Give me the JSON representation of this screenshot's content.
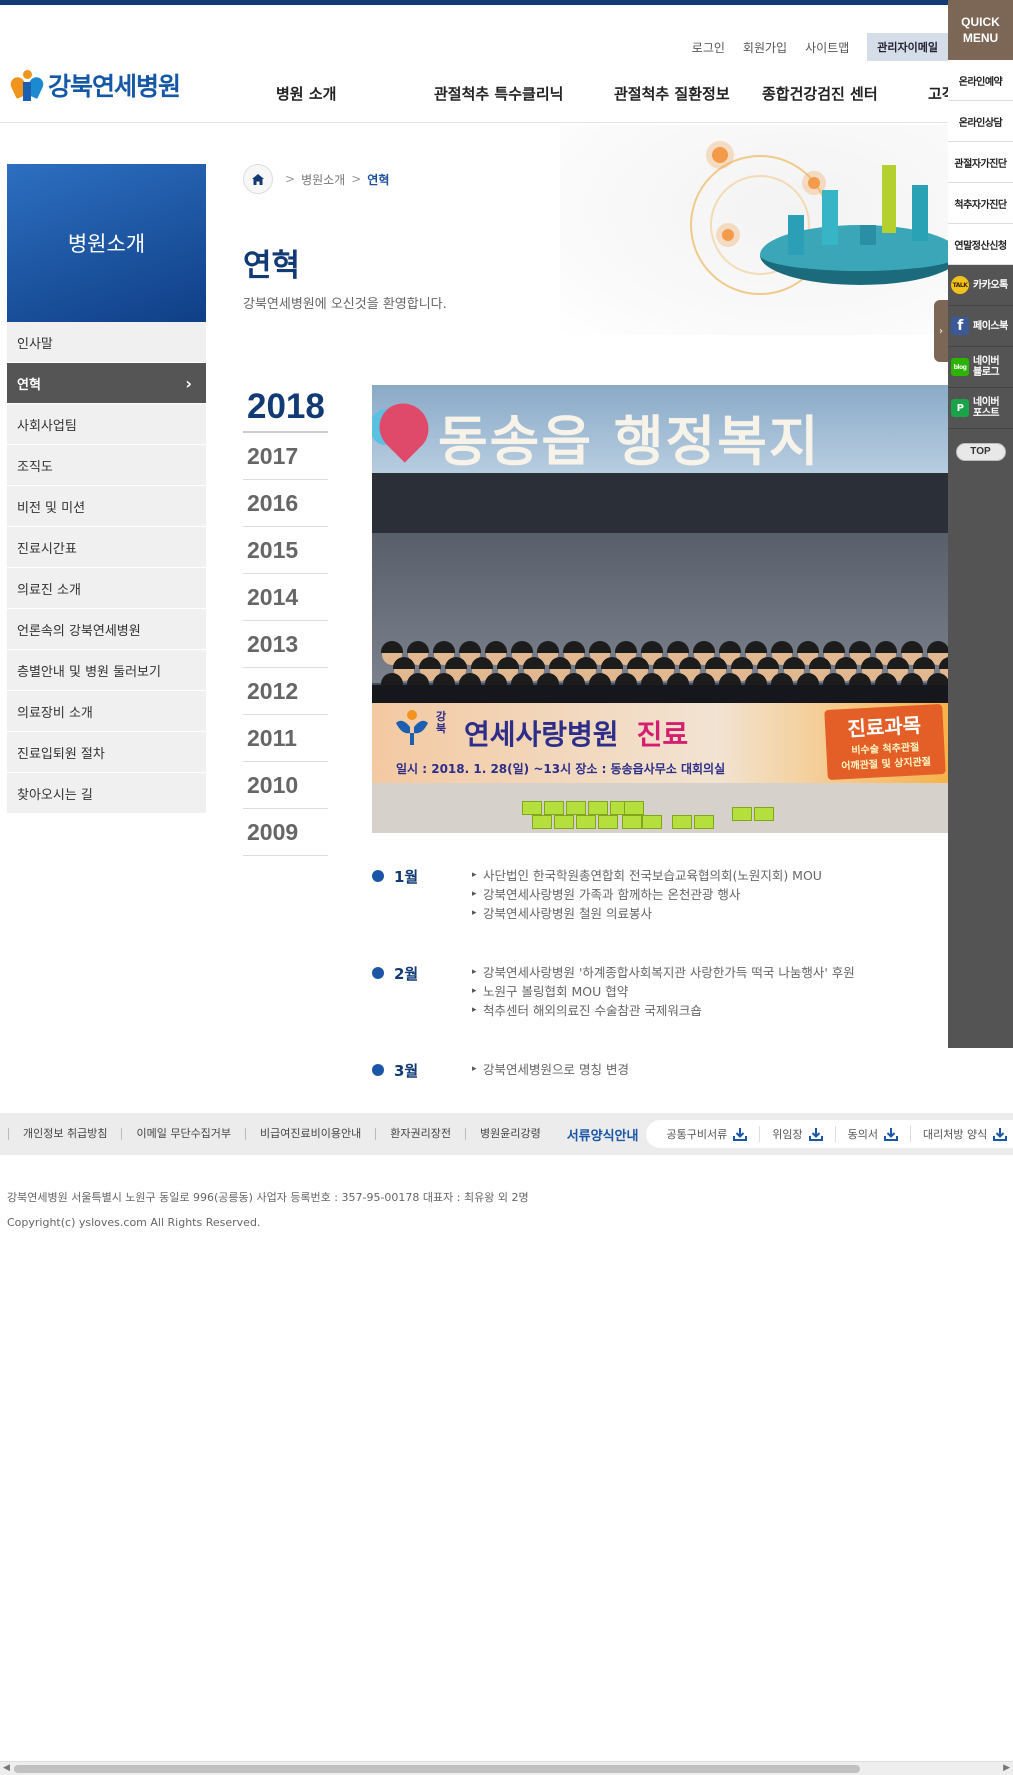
{
  "header": {
    "logo_text": "강북연세병원",
    "util_links": [
      "로그인",
      "회원가입",
      "사이트맵"
    ],
    "admin_mail": "관리자이메일",
    "gnb": [
      "병원 소개",
      "관절척추 특수클리닉",
      "관절척추 질환정보",
      "종합건강검진 센터",
      "고객"
    ]
  },
  "quick_menu": {
    "title_line1": "QUICK",
    "title_line2": "MENU",
    "items": [
      "온라인예약",
      "온라인상담",
      "관절자가진단",
      "척추자가진단",
      "연말정산신청"
    ],
    "social": [
      {
        "label": "카카오톡",
        "icon": "kakaotalk-icon",
        "color": "#f2c21b",
        "glyph": "TALK"
      },
      {
        "label": "페이스북",
        "icon": "facebook-icon",
        "color": "#3b5998",
        "glyph": "f"
      },
      {
        "label": "네이버 블로그",
        "icon": "naver-blog-icon",
        "color": "#2db400",
        "glyph": "blog"
      },
      {
        "label": "네이버 포스트",
        "icon": "naver-post-icon",
        "color": "#19a44a",
        "glyph": "P"
      }
    ],
    "top": "TOP"
  },
  "lnb": {
    "title": "병원소개",
    "items": [
      "인사말",
      "연혁",
      "사회사업팀",
      "조직도",
      "비전 및 미션",
      "진료시간표",
      "의료진 소개",
      "언론속의 강북연세병원",
      "층별안내 및 병원 둘러보기",
      "의료장비 소개",
      "진료입퇴원 절차",
      "찾아오시는 길"
    ],
    "active_index": 1
  },
  "location": {
    "parent": "병원소개",
    "current": "연혁"
  },
  "page": {
    "title": "연혁",
    "description": "강북연세병원에 오신것을 환영합니다."
  },
  "years": [
    "2018",
    "2017",
    "2016",
    "2015",
    "2014",
    "2013",
    "2012",
    "2011",
    "2010",
    "2009"
  ],
  "photo": {
    "sign": "동송읍 행정복지",
    "banner_small_logo": "강북",
    "banner_main": "연세사랑병원",
    "banner_pink": "진료",
    "banner_detail": "일시 : 2018. 1. 28(일)                   ~13시     장소 : 동송읍사무소 대회의실",
    "tag_title": "진료과목",
    "tag_line1": "비수술 척추관절",
    "tag_line2": "어깨관절 및 상지관절"
  },
  "history": [
    {
      "month": "1월",
      "items": [
        "사단법인 한국학원총연합회 전국보습교육협의회(노원지회) MOU",
        "강북연세사랑병원 가족과 함께하는 온천관광 행사",
        "강북연세사랑병원 철원 의료봉사"
      ]
    },
    {
      "month": "2월",
      "items": [
        "강북연세사랑병원 '하계종합사회복지관 사랑한가득 떡국 나눔행사' 후원",
        "노원구 볼링협회 MOU 협약",
        "척추센터 해외의료진 수술참관 국제워크숍"
      ]
    },
    {
      "month": "3월",
      "items": [
        "강북연세병원으로 명칭 변경"
      ]
    }
  ],
  "footer": {
    "links": [
      "개인정보 취급방침",
      "이메일 무단수집거부",
      "비급여진료비이용안내",
      "환자권리장전",
      "병원윤리강령"
    ],
    "forms_title": "서류양식안내",
    "forms": [
      "공통구비서류",
      "위임장",
      "동의서",
      "대리처방 양식"
    ],
    "address": "강북연세병원 서울특별시 노원구 동일로 996(공릉동) 사업자 등록번호 : 357-95-00178 대표자 : 최유왕 외 2명",
    "copyright": "Copyright(c) ysloves.com All Rights Reserved."
  },
  "colors": {
    "brand_navy": "#123a74",
    "brand_blue": "#1b56a6",
    "quick_brown": "#7c6656",
    "quick_gray": "#545454"
  }
}
